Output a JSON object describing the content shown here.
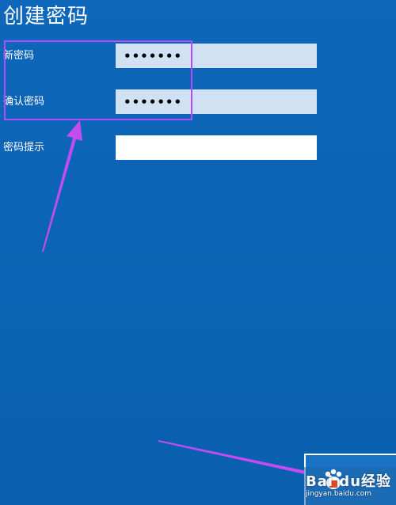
{
  "header": {
    "title": "创建密码"
  },
  "form": {
    "new_password": {
      "label": "新密码",
      "value": "•••••••"
    },
    "confirm_password": {
      "label": "确认密码",
      "value": "•••••••"
    },
    "password_hint": {
      "label": "密码提示",
      "value": ""
    }
  },
  "watermark": {
    "logo": "Bai du经验",
    "site": "jingyan.baidu.com"
  },
  "colors": {
    "background": "#0b63b6",
    "password_field": "#cfe1f2",
    "hint_field": "#ffffff",
    "annotation": "#b44bff"
  }
}
